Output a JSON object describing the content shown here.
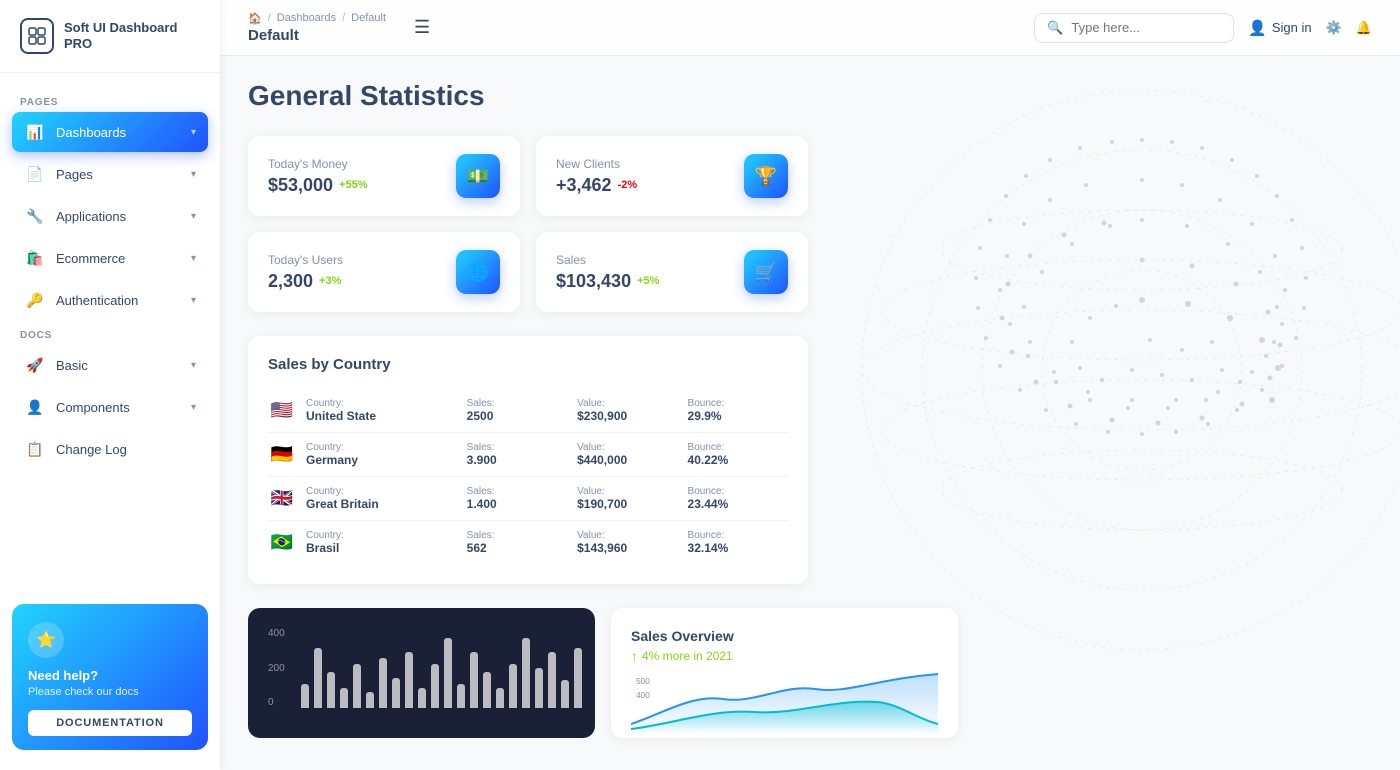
{
  "app": {
    "name": "Soft UI Dashboard PRO"
  },
  "breadcrumb": {
    "home": "🏠",
    "parent": "Dashboards",
    "current": "Default",
    "page_title": "Default"
  },
  "page": {
    "title": "General Statistics"
  },
  "stats": [
    {
      "label": "Today's Money",
      "value": "$53,000",
      "badge": "+55%",
      "badge_type": "pos",
      "icon": "💵",
      "id": "money"
    },
    {
      "label": "New Clients",
      "value": "+3,462",
      "badge": "-2%",
      "badge_type": "neg",
      "icon": "🏆",
      "id": "clients"
    },
    {
      "label": "Today's Users",
      "value": "2,300",
      "badge": "+3%",
      "badge_type": "pos",
      "icon": "🌐",
      "id": "users"
    },
    {
      "label": "Sales",
      "value": "$103,430",
      "badge": "+5%",
      "badge_type": "pos",
      "icon": "🛒",
      "id": "sales"
    }
  ],
  "sales_by_country": {
    "title": "Sales by Country",
    "rows": [
      {
        "flag": "🇺🇸",
        "country_label": "Country:",
        "country": "United State",
        "sales_label": "Sales:",
        "sales": "2500",
        "value_label": "Value:",
        "value": "$230,900",
        "bounce_label": "Bounce:",
        "bounce": "29.9%"
      },
      {
        "flag": "🇩🇪",
        "country_label": "Country:",
        "country": "Germany",
        "sales_label": "Sales:",
        "sales": "3.900",
        "value_label": "Value:",
        "value": "$440,000",
        "bounce_label": "Bounce:",
        "bounce": "40.22%"
      },
      {
        "flag": "🇬🇧",
        "country_label": "Country:",
        "country": "Great Britain",
        "sales_label": "Sales:",
        "sales": "1.400",
        "value_label": "Value:",
        "value": "$190,700",
        "bounce_label": "Bounce:",
        "bounce": "23.44%"
      },
      {
        "flag": "🇧🇷",
        "country_label": "Country:",
        "country": "Brasil",
        "sales_label": "Sales:",
        "sales": "562",
        "value_label": "Value:",
        "value": "$143,960",
        "bounce_label": "Bounce:",
        "bounce": "32.14%"
      }
    ]
  },
  "sidebar": {
    "logo_text": "Soft UI Dashboard PRO",
    "nav_section_pages": "PAGES",
    "nav_section_docs": "DOCS",
    "items_pages": [
      {
        "label": "Dashboards",
        "icon": "📊",
        "active": true,
        "has_arrow": true
      },
      {
        "label": "Pages",
        "icon": "📄",
        "active": false,
        "has_arrow": true
      },
      {
        "label": "Applications",
        "icon": "🔧",
        "active": false,
        "has_arrow": true
      },
      {
        "label": "Ecommerce",
        "icon": "🛍️",
        "active": false,
        "has_arrow": true
      },
      {
        "label": "Authentication",
        "icon": "🔑",
        "active": false,
        "has_arrow": true
      }
    ],
    "items_docs": [
      {
        "label": "Basic",
        "icon": "🚀",
        "active": false,
        "has_arrow": true
      },
      {
        "label": "Components",
        "icon": "👤",
        "active": false,
        "has_arrow": true
      },
      {
        "label": "Change Log",
        "icon": "📋",
        "active": false,
        "has_arrow": false
      }
    ],
    "help": {
      "title": "Need help?",
      "subtitle": "Please check our docs",
      "button_label": "DOCUMENTATION"
    }
  },
  "topbar": {
    "search_placeholder": "Type here...",
    "sign_in": "Sign in"
  },
  "charts": {
    "bar": {
      "y_labels": [
        "400",
        "200",
        "0"
      ],
      "bars": [
        12,
        30,
        18,
        10,
        22,
        8,
        25,
        15,
        28,
        10,
        22,
        35,
        12,
        28,
        18,
        10,
        22,
        35,
        20,
        28,
        14,
        30
      ]
    },
    "sales_overview": {
      "title": "Sales Overview",
      "badge": "4% more in 2021",
      "y_labels": [
        "500",
        "400"
      ]
    }
  }
}
